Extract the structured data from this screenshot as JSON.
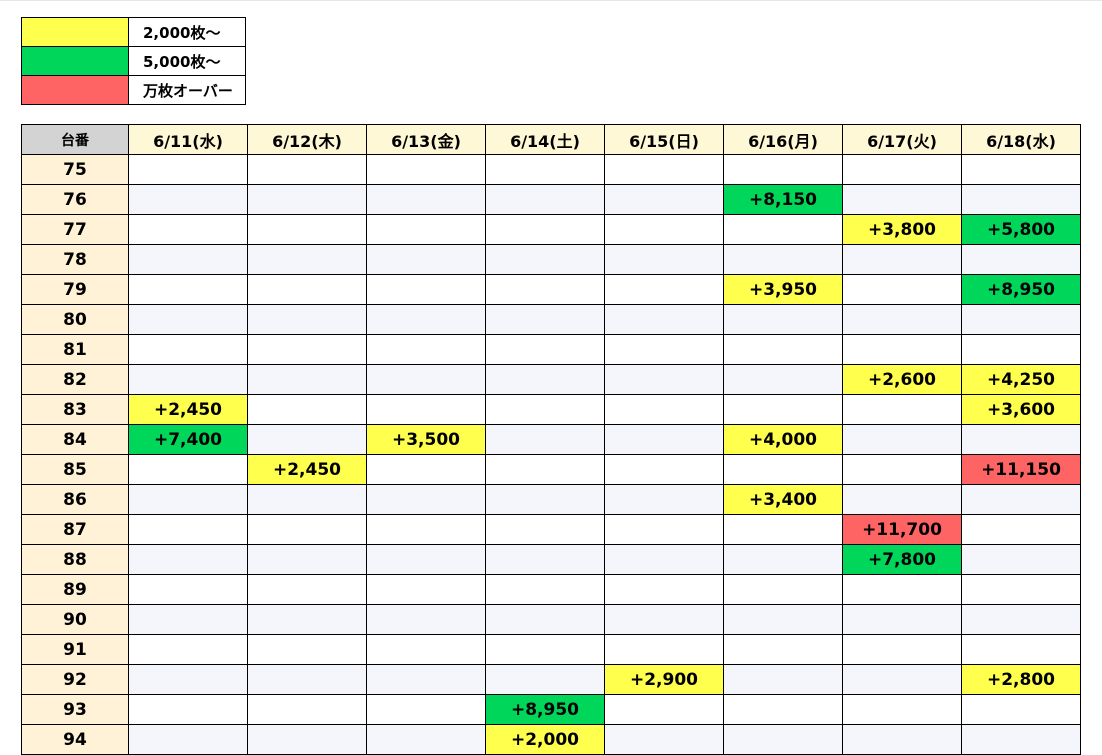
{
  "legend": {
    "items": [
      {
        "label": "2,000枚～",
        "color": "#ffff4d"
      },
      {
        "label": "5,000枚～",
        "color": "#00d65a"
      },
      {
        "label": "万枚オーバー",
        "color": "#ff6464"
      }
    ]
  },
  "grid": {
    "corner_label": "台番",
    "dates": [
      "6/11(水)",
      "6/12(木)",
      "6/13(金)",
      "6/14(土)",
      "6/15(日)",
      "6/16(月)",
      "6/17(火)",
      "6/18(水)"
    ],
    "rows": [
      {
        "machine": "75",
        "cells": [
          [
            "",
            ""
          ],
          [
            "",
            ""
          ],
          [
            "",
            ""
          ],
          [
            "",
            ""
          ],
          [
            "",
            ""
          ],
          [
            "",
            ""
          ],
          [
            "",
            ""
          ],
          [
            "",
            ""
          ]
        ]
      },
      {
        "machine": "76",
        "cells": [
          [
            "",
            ""
          ],
          [
            "",
            ""
          ],
          [
            "",
            ""
          ],
          [
            "",
            ""
          ],
          [
            "",
            ""
          ],
          [
            "+8,150",
            "g"
          ],
          [
            "",
            ""
          ],
          [
            "",
            ""
          ]
        ]
      },
      {
        "machine": "77",
        "cells": [
          [
            "",
            ""
          ],
          [
            "",
            ""
          ],
          [
            "",
            ""
          ],
          [
            "",
            ""
          ],
          [
            "",
            ""
          ],
          [
            "",
            ""
          ],
          [
            "+3,800",
            "y"
          ],
          [
            "+5,800",
            "g"
          ]
        ]
      },
      {
        "machine": "78",
        "cells": [
          [
            "",
            ""
          ],
          [
            "",
            ""
          ],
          [
            "",
            ""
          ],
          [
            "",
            ""
          ],
          [
            "",
            ""
          ],
          [
            "",
            ""
          ],
          [
            "",
            ""
          ],
          [
            "",
            ""
          ]
        ]
      },
      {
        "machine": "79",
        "cells": [
          [
            "",
            ""
          ],
          [
            "",
            ""
          ],
          [
            "",
            ""
          ],
          [
            "",
            ""
          ],
          [
            "",
            ""
          ],
          [
            "+3,950",
            "y"
          ],
          [
            "",
            ""
          ],
          [
            "+8,950",
            "g"
          ]
        ]
      },
      {
        "machine": "80",
        "cells": [
          [
            "",
            ""
          ],
          [
            "",
            ""
          ],
          [
            "",
            ""
          ],
          [
            "",
            ""
          ],
          [
            "",
            ""
          ],
          [
            "",
            ""
          ],
          [
            "",
            ""
          ],
          [
            "",
            ""
          ]
        ]
      },
      {
        "machine": "81",
        "cells": [
          [
            "",
            ""
          ],
          [
            "",
            ""
          ],
          [
            "",
            ""
          ],
          [
            "",
            ""
          ],
          [
            "",
            ""
          ],
          [
            "",
            ""
          ],
          [
            "",
            ""
          ],
          [
            "",
            ""
          ]
        ]
      },
      {
        "machine": "82",
        "cells": [
          [
            "",
            ""
          ],
          [
            "",
            ""
          ],
          [
            "",
            ""
          ],
          [
            "",
            ""
          ],
          [
            "",
            ""
          ],
          [
            "",
            ""
          ],
          [
            "+2,600",
            "y"
          ],
          [
            "+4,250",
            "y"
          ]
        ]
      },
      {
        "machine": "83",
        "cells": [
          [
            "+2,450",
            "y"
          ],
          [
            "",
            ""
          ],
          [
            "",
            ""
          ],
          [
            "",
            ""
          ],
          [
            "",
            ""
          ],
          [
            "",
            ""
          ],
          [
            "",
            ""
          ],
          [
            "+3,600",
            "y"
          ]
        ]
      },
      {
        "machine": "84",
        "cells": [
          [
            "+7,400",
            "g"
          ],
          [
            "",
            ""
          ],
          [
            "+3,500",
            "y"
          ],
          [
            "",
            ""
          ],
          [
            "",
            ""
          ],
          [
            "+4,000",
            "y"
          ],
          [
            "",
            ""
          ],
          [
            "",
            ""
          ]
        ]
      },
      {
        "machine": "85",
        "cells": [
          [
            "",
            ""
          ],
          [
            "+2,450",
            "y"
          ],
          [
            "",
            ""
          ],
          [
            "",
            ""
          ],
          [
            "",
            ""
          ],
          [
            "",
            ""
          ],
          [
            "",
            ""
          ],
          [
            "+11,150",
            "r"
          ]
        ]
      },
      {
        "machine": "86",
        "cells": [
          [
            "",
            ""
          ],
          [
            "",
            ""
          ],
          [
            "",
            ""
          ],
          [
            "",
            ""
          ],
          [
            "",
            ""
          ],
          [
            "+3,400",
            "y"
          ],
          [
            "",
            ""
          ],
          [
            "",
            ""
          ]
        ]
      },
      {
        "machine": "87",
        "cells": [
          [
            "",
            ""
          ],
          [
            "",
            ""
          ],
          [
            "",
            ""
          ],
          [
            "",
            ""
          ],
          [
            "",
            ""
          ],
          [
            "",
            ""
          ],
          [
            "+11,700",
            "r"
          ],
          [
            "",
            ""
          ]
        ]
      },
      {
        "machine": "88",
        "cells": [
          [
            "",
            ""
          ],
          [
            "",
            ""
          ],
          [
            "",
            ""
          ],
          [
            "",
            ""
          ],
          [
            "",
            ""
          ],
          [
            "",
            ""
          ],
          [
            "+7,800",
            "g"
          ],
          [
            "",
            ""
          ]
        ]
      },
      {
        "machine": "89",
        "cells": [
          [
            "",
            ""
          ],
          [
            "",
            ""
          ],
          [
            "",
            ""
          ],
          [
            "",
            ""
          ],
          [
            "",
            ""
          ],
          [
            "",
            ""
          ],
          [
            "",
            ""
          ],
          [
            "",
            ""
          ]
        ]
      },
      {
        "machine": "90",
        "cells": [
          [
            "",
            ""
          ],
          [
            "",
            ""
          ],
          [
            "",
            ""
          ],
          [
            "",
            ""
          ],
          [
            "",
            ""
          ],
          [
            "",
            ""
          ],
          [
            "",
            ""
          ],
          [
            "",
            ""
          ]
        ]
      },
      {
        "machine": "91",
        "cells": [
          [
            "",
            ""
          ],
          [
            "",
            ""
          ],
          [
            "",
            ""
          ],
          [
            "",
            ""
          ],
          [
            "",
            ""
          ],
          [
            "",
            ""
          ],
          [
            "",
            ""
          ],
          [
            "",
            ""
          ]
        ]
      },
      {
        "machine": "92",
        "cells": [
          [
            "",
            ""
          ],
          [
            "",
            ""
          ],
          [
            "",
            ""
          ],
          [
            "",
            ""
          ],
          [
            "+2,900",
            "y"
          ],
          [
            "",
            ""
          ],
          [
            "",
            ""
          ],
          [
            "+2,800",
            "y"
          ]
        ]
      },
      {
        "machine": "93",
        "cells": [
          [
            "",
            ""
          ],
          [
            "",
            ""
          ],
          [
            "",
            ""
          ],
          [
            "+8,950",
            "g"
          ],
          [
            "",
            ""
          ],
          [
            "",
            ""
          ],
          [
            "",
            ""
          ],
          [
            "",
            ""
          ]
        ]
      },
      {
        "machine": "94",
        "cells": [
          [
            "",
            ""
          ],
          [
            "",
            ""
          ],
          [
            "",
            ""
          ],
          [
            "+2,000",
            "y"
          ],
          [
            "",
            ""
          ],
          [
            "",
            ""
          ],
          [
            "",
            ""
          ],
          [
            "",
            ""
          ]
        ]
      }
    ]
  }
}
